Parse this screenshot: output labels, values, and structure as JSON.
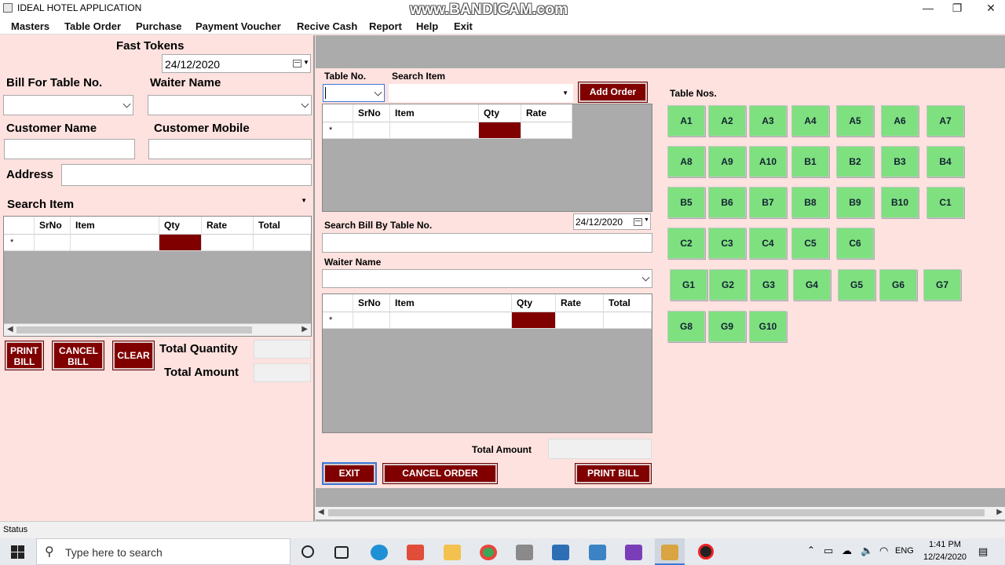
{
  "window": {
    "title": "IDEAL HOTEL APPLICATION",
    "watermark": "www.BANDICAM.com",
    "minimize": "—",
    "restore": "❐",
    "close": "✕"
  },
  "menu": [
    "Masters",
    "Table Order",
    "Purchase",
    "Payment Voucher",
    "Recive Cash",
    "Report",
    "Help",
    "Exit"
  ],
  "left_panel": {
    "fast_tokens_label": "Fast Tokens",
    "date": "24/12/2020",
    "bill_for_table_label": "Bill For Table No.",
    "waiter_name_label": "Waiter Name",
    "customer_name_label": "Customer Name",
    "customer_mobile_label": "Customer Mobile",
    "address_label": "Address",
    "search_item_label": "Search Item",
    "grid_columns": [
      "SrNo",
      "Item",
      "Qty",
      "Rate",
      "Total"
    ],
    "row_marker": "*",
    "print_bill_btn": "PRINT BILL",
    "cancel_bill_btn": "CANCEL BILL",
    "clear_btn": "CLEAR",
    "total_quantity_label": "Total Quantity",
    "total_amount_label": "Total Amount"
  },
  "order_panel": {
    "table_no_label": "Table No.",
    "search_item_label": "Search Item",
    "add_order_btn": "Add Order",
    "grid_columns": [
      "SrNo",
      "Item",
      "Qty",
      "Rate"
    ],
    "row_marker": "*",
    "search_bill_label": "Search Bill By Table No.",
    "date": "24/12/2020",
    "waiter_name_label": "Waiter Name",
    "bill_grid_columns": [
      "SrNo",
      "Item",
      "Qty",
      "Rate",
      "Total"
    ],
    "total_amount_label": "Total Amount",
    "exit_btn": "EXIT",
    "cancel_order_btn": "CANCEL ORDER",
    "print_bill_btn": "PRINT BILL"
  },
  "tables": {
    "label": "Table Nos.",
    "rows": [
      [
        "A1",
        "A2",
        "A3",
        "A4",
        "A5",
        "A6",
        "A7"
      ],
      [
        "A8",
        "A9",
        "A10",
        "B1",
        "B2",
        "B3",
        "B4"
      ],
      [
        "B5",
        "B6",
        "B7",
        "B8",
        "B9",
        "B10",
        "C1"
      ],
      [
        "C2",
        "C3",
        "C4",
        "C5",
        "C6"
      ],
      [
        "G1",
        "G2",
        "G3",
        "G4",
        "G5",
        "G6",
        "G7"
      ],
      [
        "G8",
        "G9",
        "G10"
      ]
    ]
  },
  "status": "Status",
  "taskbar": {
    "search_placeholder": "Type here to search",
    "lang": "ENG",
    "time": "1:41 PM",
    "date": "12/24/2020"
  },
  "colors": {
    "background": "#fde2df",
    "accent_dark_red": "#800000",
    "table_green": "#7fe07f",
    "panel_gray": "#ababab"
  }
}
